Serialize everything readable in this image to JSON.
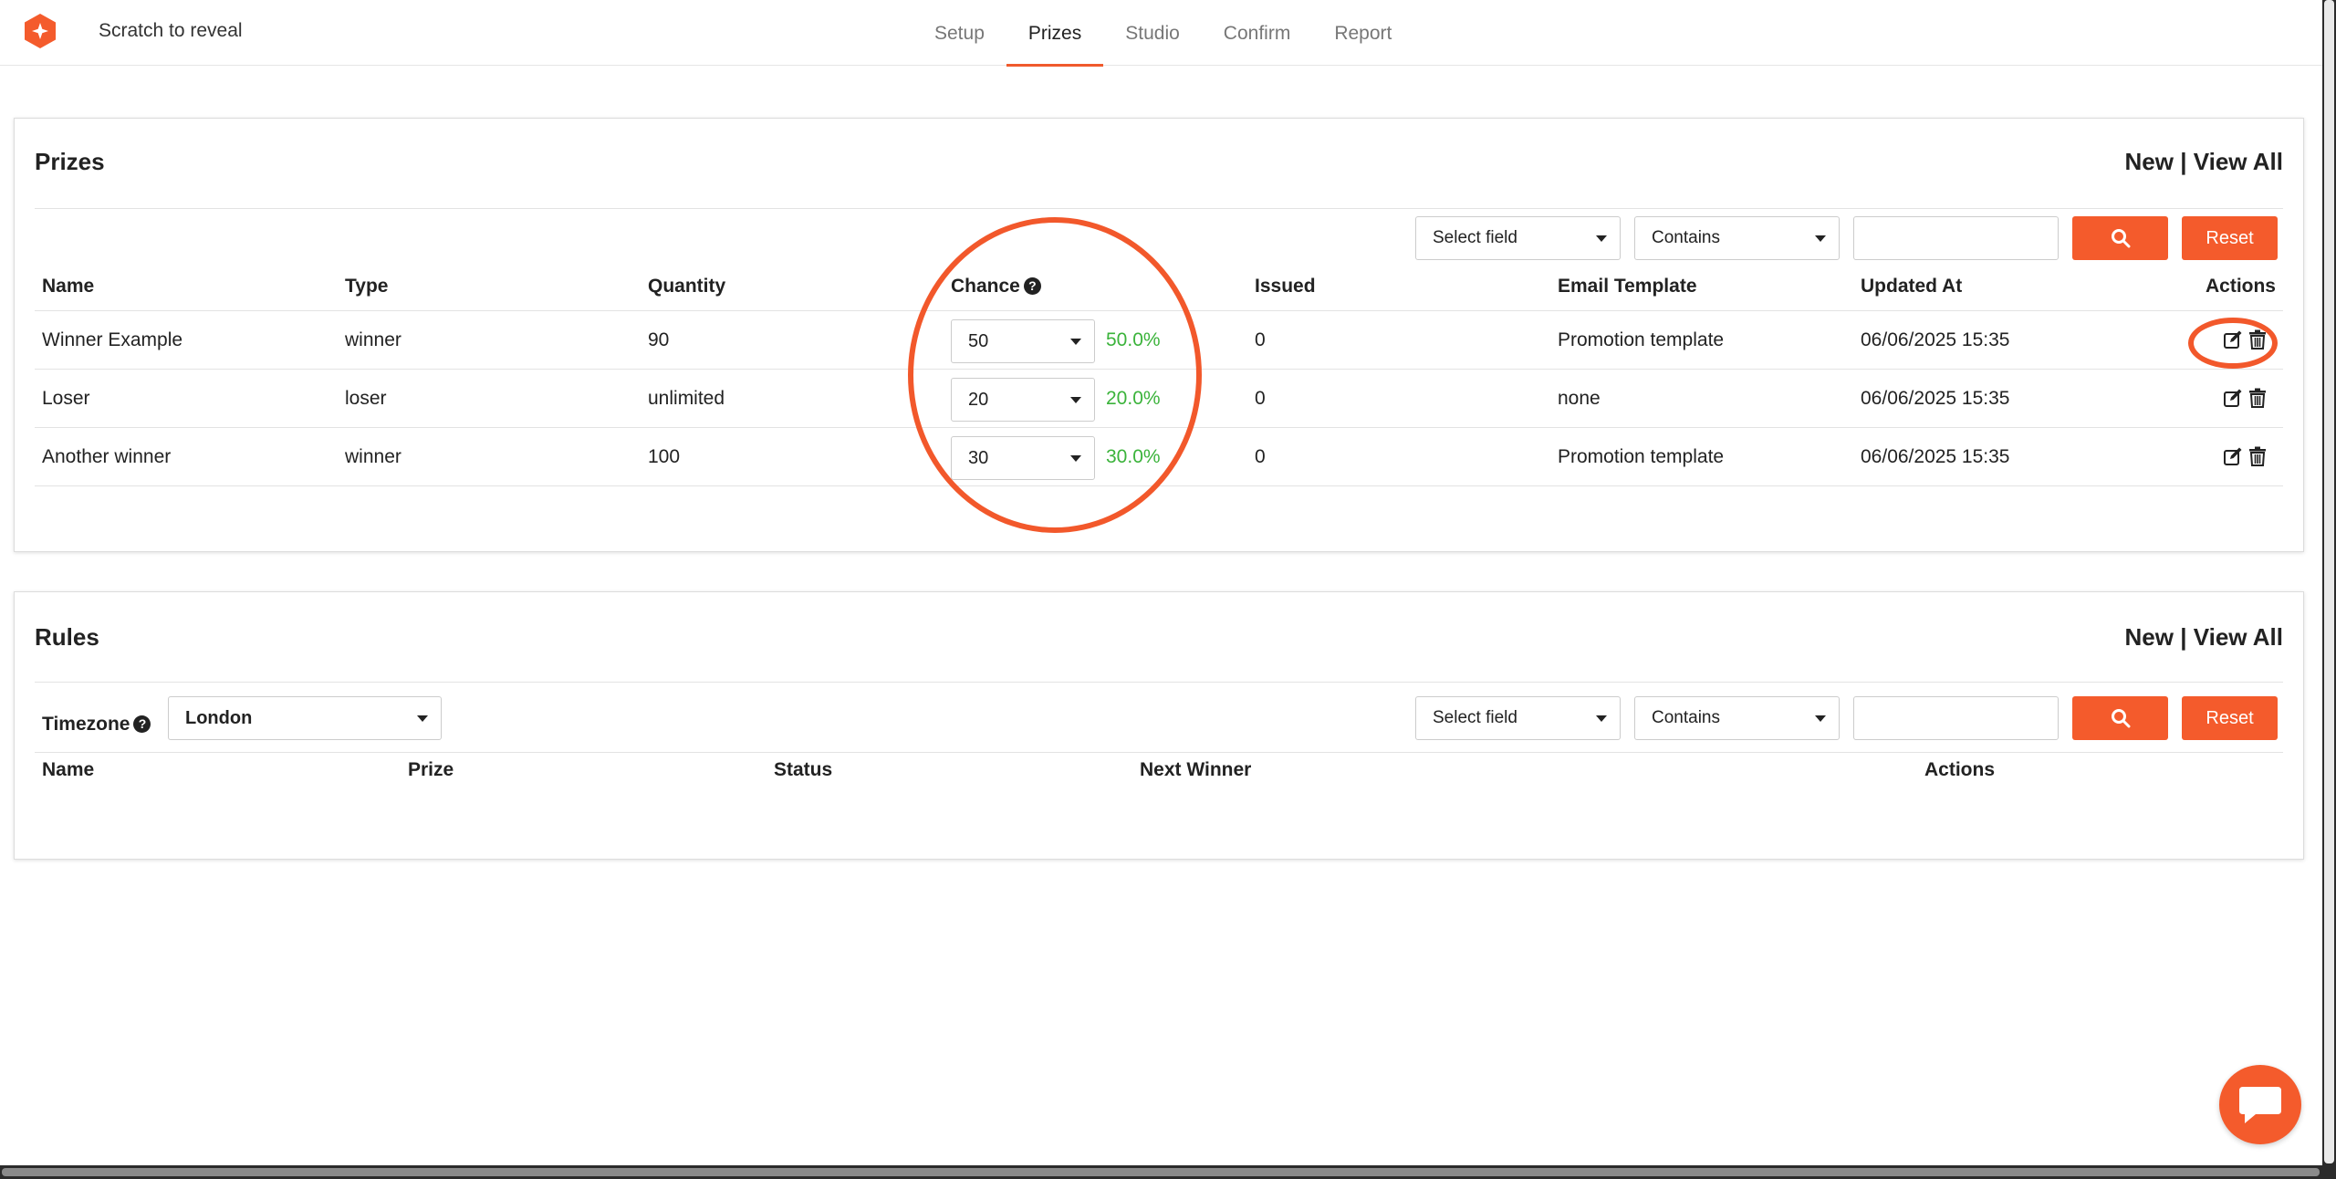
{
  "header": {
    "app_title": "Scratch to reveal",
    "tabs": [
      {
        "label": "Setup",
        "active": false
      },
      {
        "label": "Prizes",
        "active": true
      },
      {
        "label": "Studio",
        "active": false
      },
      {
        "label": "Confirm",
        "active": false
      },
      {
        "label": "Report",
        "active": false
      }
    ]
  },
  "colors": {
    "accent": "#f45b2c",
    "percent": "#3bb33b"
  },
  "prizes": {
    "title": "Prizes",
    "new_label": "New",
    "separator": "|",
    "view_all_label": "View All",
    "filter": {
      "field_select": "Select field",
      "operator_select": "Contains",
      "search_value": "",
      "search_icon": "search-icon",
      "reset_label": "Reset"
    },
    "columns": {
      "name": "Name",
      "type": "Type",
      "quantity": "Quantity",
      "chance": "Chance",
      "chance_help": "?",
      "issued": "Issued",
      "email_template": "Email Template",
      "updated_at": "Updated At",
      "actions": "Actions"
    },
    "rows": [
      {
        "name": "Winner Example",
        "type": "winner",
        "quantity": "90",
        "chance": "50",
        "percent": "50.0%",
        "issued": "0",
        "email_template": "Promotion template",
        "updated_at": "06/06/2025 15:35"
      },
      {
        "name": "Loser",
        "type": "loser",
        "quantity": "unlimited",
        "chance": "20",
        "percent": "20.0%",
        "issued": "0",
        "email_template": "none",
        "updated_at": "06/06/2025 15:35"
      },
      {
        "name": "Another winner",
        "type": "winner",
        "quantity": "100",
        "chance": "30",
        "percent": "30.0%",
        "issued": "0",
        "email_template": "Promotion template",
        "updated_at": "06/06/2025 15:35"
      }
    ]
  },
  "rules": {
    "title": "Rules",
    "new_label": "New",
    "separator": "|",
    "view_all_label": "View All",
    "timezone_label": "Timezone",
    "timezone_help": "?",
    "timezone_value": "London",
    "filter": {
      "field_select": "Select field",
      "operator_select": "Contains",
      "search_value": "",
      "reset_label": "Reset"
    },
    "columns": {
      "name": "Name",
      "prize": "Prize",
      "status": "Status",
      "next_winner": "Next Winner",
      "actions": "Actions"
    }
  }
}
